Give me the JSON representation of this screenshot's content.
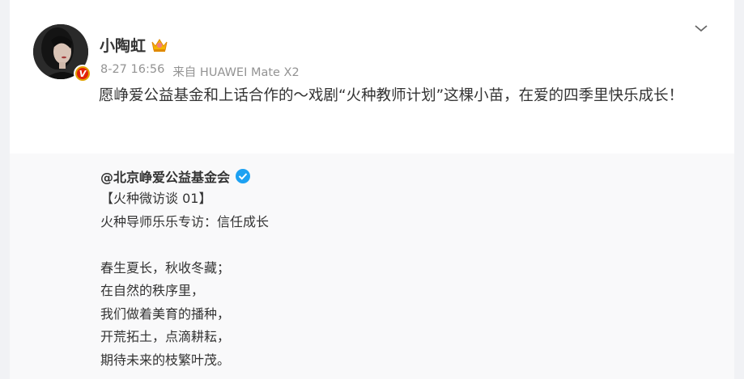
{
  "post": {
    "username": "小陶虹",
    "date": "8-27 16:56",
    "source": "来自 HUAWEI Mate X2",
    "text": "愿峥爱公益基金和上话合作的～戏剧“火种教师计划”这棵小苗，在爱的四季里快乐成长！",
    "verified_badge": "V"
  },
  "repost": {
    "author": "@北京峥爱公益基金会",
    "lines": [
      "【火种微访谈 01】",
      "火种导师乐乐专访：信任成长",
      "",
      "春生夏长，秋收冬藏；",
      "在自然的秩序里，",
      "我们做着美育的播种，",
      "开荒拓土，点滴耕耘，",
      "期待未来的枝繁叶茂。"
    ]
  },
  "colors": {
    "card_bg": "#ffffff",
    "page_bg": "#f1f2f5",
    "repost_bg": "#f9f9fa",
    "meta_text": "#939393",
    "verified_blue": "#1da1f2",
    "badge_orange": "#e2a100"
  },
  "icons": {
    "crown": "crown-icon",
    "verified": "verified-blue-icon",
    "menu": "chevron-down-icon",
    "avatar_badge": "v-badge-icon"
  }
}
